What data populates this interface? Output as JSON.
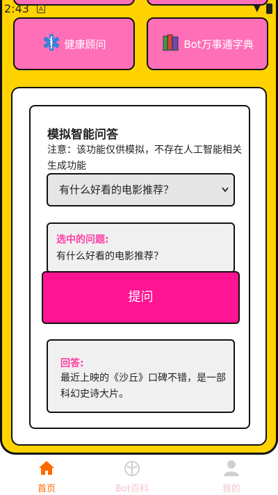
{
  "status": {
    "time": "2:43",
    "notif": "A"
  },
  "features": [
    {
      "label": "健康顾问",
      "icon": "medical-staff-icon"
    },
    {
      "label": "Bot万事通字典",
      "icon": "books-icon"
    }
  ],
  "qa": {
    "title": "模拟智能问答",
    "note": "注意：该功能仅供模拟，不存在人工智能相关生成功能",
    "select_value": "有什么好看的电影推荐？",
    "selected_label": "选中的问题:",
    "selected_text": "有什么好看的电影推荐？",
    "ask_label": "提问",
    "answer_label": "回答:",
    "answer_text": "最近上映的《沙丘》口碑不错，是一部科幻史诗大片。"
  },
  "nav": [
    {
      "label": "首页",
      "icon": "home-icon",
      "active": true
    },
    {
      "label": "Bot百科",
      "icon": "encyclopedia-icon",
      "active": false
    },
    {
      "label": "我的",
      "icon": "user-icon",
      "active": false
    }
  ],
  "colors": {
    "background": "#FFD200",
    "card_pink": "#FF6FB8",
    "button_pink": "#FF1493",
    "label_pink": "#FF3EA5",
    "nav_active": "#FF6A00"
  }
}
